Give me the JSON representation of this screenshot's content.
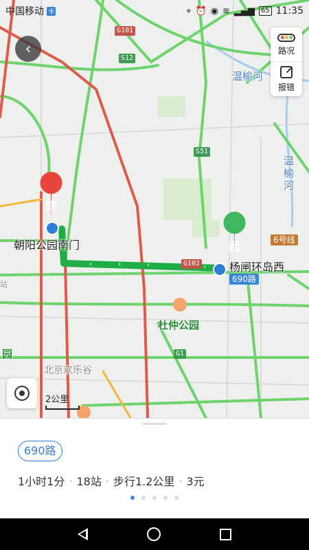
{
  "status_bar": {
    "carrier": "中国移动",
    "carrier_badge": "卡",
    "battery": "65",
    "time": "11:35",
    "icons": [
      "location-icon",
      "alarm-icon",
      "eye-icon",
      "wifi-icon",
      "signal-icon",
      "battery-icon"
    ]
  },
  "map": {
    "labels": {
      "destination_stop": "朝阳公园南门",
      "origin_stop": "杨闸环岛西",
      "park": "杜仲公园",
      "river_h": "温榆河",
      "river_v": "温榆河",
      "poi_happy_valley": "北京欢乐谷",
      "poi_park_edge": "园",
      "poi_edge_left": "站"
    },
    "markers": {
      "end": "终",
      "start": "起"
    },
    "shields": {
      "g101": "G101",
      "s12": "S12",
      "s51": "S51",
      "g102": "G102",
      "g1": "G1"
    },
    "metro_line": "6号线",
    "bus_line_tag": "690路",
    "scale": "2公里",
    "colors": {
      "route": "#1fae45",
      "traffic_green": "#6dd36c",
      "traffic_red": "#e05a4c",
      "traffic_yellow": "#f0b73a",
      "accent": "#3a86d6"
    }
  },
  "controls": {
    "back": "‹",
    "traffic": "路况",
    "report": "报错"
  },
  "route_card": {
    "route_name": "690路",
    "duration": "1小时1分",
    "stops": "18站",
    "walk": "步行1.2公里",
    "price": "3元",
    "separator": "·",
    "pager": {
      "total": 5,
      "active": 1
    }
  }
}
